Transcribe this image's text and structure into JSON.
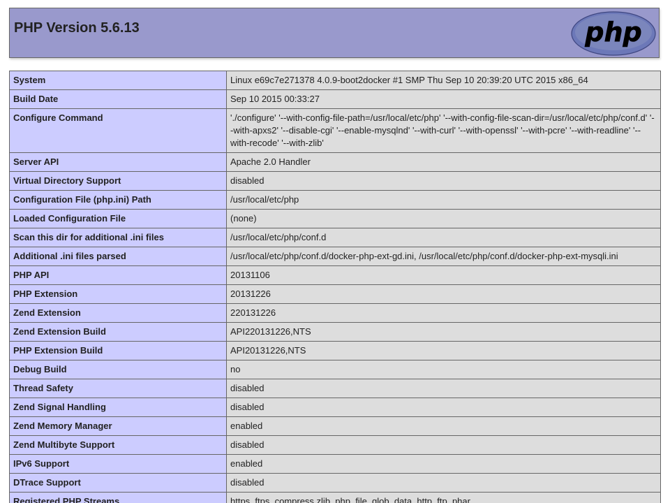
{
  "header": {
    "title": "PHP Version 5.6.13",
    "logo_text": "php"
  },
  "colors": {
    "header_bg": "#9999cc",
    "label_bg": "#ccccff",
    "value_bg": "#dddddd",
    "border": "#666666",
    "logo_fill": "#6c78b8"
  },
  "rows": [
    {
      "label": "System",
      "value": "Linux e69c7e271378 4.0.9-boot2docker #1 SMP Thu Sep 10 20:39:20 UTC 2015 x86_64"
    },
    {
      "label": "Build Date",
      "value": "Sep 10 2015 00:33:27"
    },
    {
      "label": "Configure Command",
      "value": "'./configure' '--with-config-file-path=/usr/local/etc/php' '--with-config-file-scan-dir=/usr/local/etc/php/conf.d' '--with-apxs2' '--disable-cgi' '--enable-mysqlnd' '--with-curl' '--with-openssl' '--with-pcre' '--with-readline' '--with-recode' '--with-zlib'"
    },
    {
      "label": "Server API",
      "value": "Apache 2.0 Handler"
    },
    {
      "label": "Virtual Directory Support",
      "value": "disabled"
    },
    {
      "label": "Configuration File (php.ini) Path",
      "value": "/usr/local/etc/php"
    },
    {
      "label": "Loaded Configuration File",
      "value": "(none)"
    },
    {
      "label": "Scan this dir for additional .ini files",
      "value": "/usr/local/etc/php/conf.d"
    },
    {
      "label": "Additional .ini files parsed",
      "value": "/usr/local/etc/php/conf.d/docker-php-ext-gd.ini, /usr/local/etc/php/conf.d/docker-php-ext-mysqli.ini"
    },
    {
      "label": "PHP API",
      "value": "20131106"
    },
    {
      "label": "PHP Extension",
      "value": "20131226"
    },
    {
      "label": "Zend Extension",
      "value": "220131226"
    },
    {
      "label": "Zend Extension Build",
      "value": "API220131226,NTS"
    },
    {
      "label": "PHP Extension Build",
      "value": "API20131226,NTS"
    },
    {
      "label": "Debug Build",
      "value": "no"
    },
    {
      "label": "Thread Safety",
      "value": "disabled"
    },
    {
      "label": "Zend Signal Handling",
      "value": "disabled"
    },
    {
      "label": "Zend Memory Manager",
      "value": "enabled"
    },
    {
      "label": "Zend Multibyte Support",
      "value": "disabled"
    },
    {
      "label": "IPv6 Support",
      "value": "enabled"
    },
    {
      "label": "DTrace Support",
      "value": "disabled"
    },
    {
      "label": "Registered PHP Streams",
      "value": "https, ftps, compress.zlib, php, file, glob, data, http, ftp, phar"
    }
  ]
}
